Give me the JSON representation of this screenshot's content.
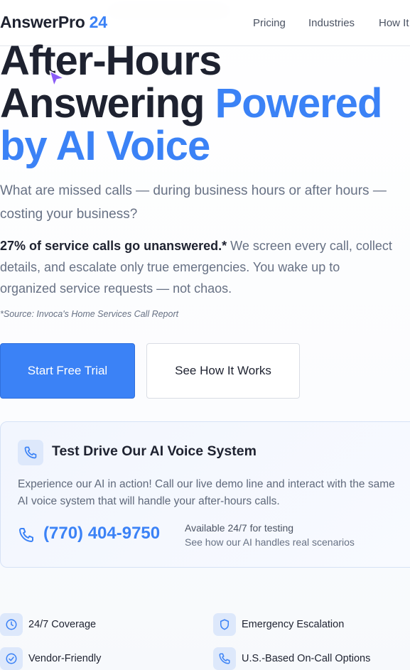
{
  "nav": {
    "brand": "AnswerPro",
    "brand_number": "24",
    "links": [
      "Pricing",
      "Industries",
      "How It"
    ]
  },
  "hero": {
    "headline_line1": "After-Hours",
    "headline_line2_dark": "Answering",
    "headline_line2_blue": "Powered",
    "headline_line3_blue": "by AI Voice",
    "subtitle": "What are missed calls — during business hours or after hours — costing your business?",
    "stat_bold": "27% of service calls go unanswered.*",
    "stat_text": "We screen every call, collect details, and escalate only true emergencies. You wake up to organized service requests — not chaos.",
    "source": "*Source: Invoca's Home Services Call Report",
    "primary_cta": "Start Free Trial",
    "secondary_cta": "See How It Works"
  },
  "demo": {
    "title": "Test Drive Our AI Voice System",
    "description": "Experience our AI in action! Call our live demo line and interact with the same AI voice system that will handle your after-hours calls.",
    "phone": "(770) 404-9750",
    "availability": "Available 24/7 for testing",
    "availability_sub": "See how our AI handles real scenarios"
  },
  "features": [
    {
      "label": "24/7 Coverage",
      "icon": "clock-icon"
    },
    {
      "label": "Emergency Escalation",
      "icon": "shield-icon"
    },
    {
      "label": "Vendor-Friendly",
      "icon": "check-circle-icon"
    },
    {
      "label": "U.S.-Based On-Call Options",
      "icon": "phone-icon"
    }
  ],
  "colors": {
    "accent": "#3b82f6",
    "heading": "#1e2230",
    "muted": "#677184",
    "cursor": "#8b5cf6"
  }
}
